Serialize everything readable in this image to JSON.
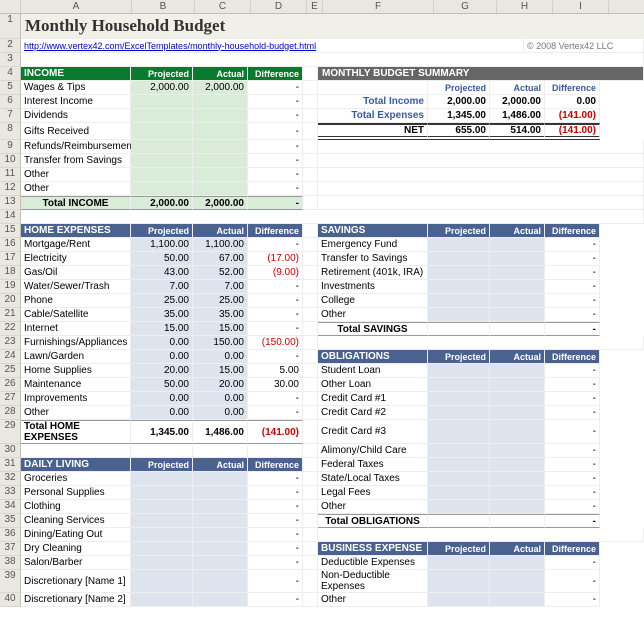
{
  "title": "Monthly Household Budget",
  "link": "http://www.vertex42.com/ExcelTemplates/monthly-household-budget.html",
  "copyright": "© 2008 Vertex42 LLC",
  "cols": [
    "A",
    "B",
    "C",
    "D",
    "E",
    "F",
    "G",
    "H",
    "I"
  ],
  "hdr": {
    "proj": "Projected",
    "act": "Actual",
    "diff": "Difference"
  },
  "income": {
    "title": "INCOME",
    "rows": [
      {
        "label": "Wages & Tips",
        "p": "2,000.00",
        "a": "2,000.00",
        "d": "-"
      },
      {
        "label": "Interest Income",
        "p": "",
        "a": "",
        "d": "-"
      },
      {
        "label": "Dividends",
        "p": "",
        "a": "",
        "d": "-"
      },
      {
        "label": "Gifts Received",
        "p": "",
        "a": "",
        "d": "-"
      },
      {
        "label": "Refunds/Reimbursements",
        "p": "",
        "a": "",
        "d": "-"
      },
      {
        "label": "Transfer from Savings",
        "p": "",
        "a": "",
        "d": "-"
      },
      {
        "label": "Other",
        "p": "",
        "a": "",
        "d": "-"
      },
      {
        "label": "Other",
        "p": "",
        "a": "",
        "d": "-"
      }
    ],
    "total": {
      "label": "Total INCOME",
      "p": "2,000.00",
      "a": "2,000.00",
      "d": "-"
    }
  },
  "summary": {
    "title": "MONTHLY BUDGET SUMMARY",
    "rows": [
      {
        "label": "Total Income",
        "p": "2,000.00",
        "a": "2,000.00",
        "d": "0.00"
      },
      {
        "label": "Total Expenses",
        "p": "1,345.00",
        "a": "1,486.00",
        "d": "(141.00)",
        "neg": true
      }
    ],
    "net": {
      "label": "NET",
      "p": "655.00",
      "a": "514.00",
      "d": "(141.00)",
      "neg": true
    }
  },
  "home": {
    "title": "HOME EXPENSES",
    "rows": [
      {
        "label": "Mortgage/Rent",
        "p": "1,100.00",
        "a": "1,100.00",
        "d": "-"
      },
      {
        "label": "Electricity",
        "p": "50.00",
        "a": "67.00",
        "d": "(17.00)",
        "neg": true
      },
      {
        "label": "Gas/Oil",
        "p": "43.00",
        "a": "52.00",
        "d": "(9.00)",
        "neg": true
      },
      {
        "label": "Water/Sewer/Trash",
        "p": "7.00",
        "a": "7.00",
        "d": "-"
      },
      {
        "label": "Phone",
        "p": "25.00",
        "a": "25.00",
        "d": "-"
      },
      {
        "label": "Cable/Satellite",
        "p": "35.00",
        "a": "35.00",
        "d": "-"
      },
      {
        "label": "Internet",
        "p": "15.00",
        "a": "15.00",
        "d": "-"
      },
      {
        "label": "Furnishings/Appliances",
        "p": "0.00",
        "a": "150.00",
        "d": "(150.00)",
        "neg": true
      },
      {
        "label": "Lawn/Garden",
        "p": "0.00",
        "a": "0.00",
        "d": "-"
      },
      {
        "label": "Home Supplies",
        "p": "20.00",
        "a": "15.00",
        "d": "5.00"
      },
      {
        "label": "Maintenance",
        "p": "50.00",
        "a": "20.00",
        "d": "30.00"
      },
      {
        "label": "Improvements",
        "p": "0.00",
        "a": "0.00",
        "d": "-"
      },
      {
        "label": "Other",
        "p": "0.00",
        "a": "0.00",
        "d": "-"
      }
    ],
    "total": {
      "label": "Total HOME EXPENSES",
      "p": "1,345.00",
      "a": "1,486.00",
      "d": "(141.00)",
      "neg": true
    }
  },
  "savings": {
    "title": "SAVINGS",
    "rows": [
      {
        "label": "Emergency Fund"
      },
      {
        "label": "Transfer to Savings"
      },
      {
        "label": "Retirement (401k, IRA)"
      },
      {
        "label": "Investments"
      },
      {
        "label": "College"
      },
      {
        "label": "Other"
      }
    ],
    "total": {
      "label": "Total SAVINGS"
    }
  },
  "obligations": {
    "title": "OBLIGATIONS",
    "rows": [
      {
        "label": "Student Loan"
      },
      {
        "label": "Other Loan"
      },
      {
        "label": "Credit Card #1"
      },
      {
        "label": "Credit Card #2"
      },
      {
        "label": "Credit Card #3"
      },
      {
        "label": "Alimony/Child Care"
      },
      {
        "label": "Federal Taxes"
      },
      {
        "label": "State/Local Taxes"
      },
      {
        "label": "Legal Fees"
      },
      {
        "label": "Other"
      }
    ],
    "total": {
      "label": "Total OBLIGATIONS"
    }
  },
  "daily": {
    "title": "DAILY LIVING",
    "rows": [
      {
        "label": "Groceries"
      },
      {
        "label": "Personal Supplies"
      },
      {
        "label": "Clothing"
      },
      {
        "label": "Cleaning Services"
      },
      {
        "label": "Dining/Eating Out"
      },
      {
        "label": "Dry Cleaning"
      },
      {
        "label": "Salon/Barber"
      },
      {
        "label": "Discretionary [Name 1]"
      },
      {
        "label": "Discretionary [Name 2]"
      }
    ]
  },
  "business": {
    "title": "BUSINESS EXPENSE",
    "rows": [
      {
        "label": "Deductible Expenses"
      },
      {
        "label": "Non-Deductible Expenses"
      },
      {
        "label": "Other"
      }
    ]
  }
}
